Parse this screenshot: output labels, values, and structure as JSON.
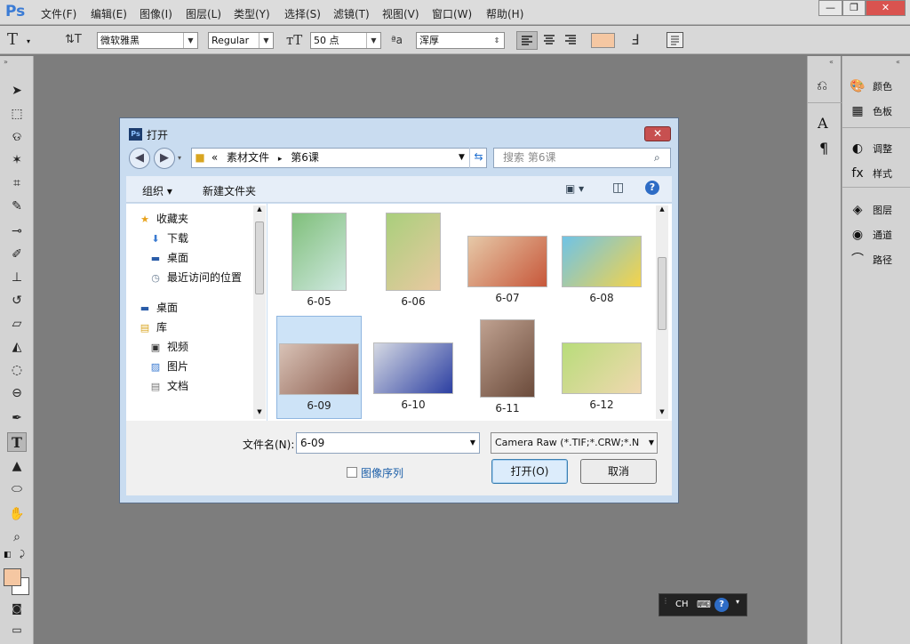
{
  "app": {
    "logo": "Ps"
  },
  "menu": [
    "文件(F)",
    "编辑(E)",
    "图像(I)",
    "图层(L)",
    "类型(Y)",
    "选择(S)",
    "滤镜(T)",
    "视图(V)",
    "窗口(W)",
    "帮助(H)"
  ],
  "window_controls": {
    "minimize": "—",
    "restore": "❐",
    "close": "✕"
  },
  "options": {
    "font_family": "微软雅黑",
    "font_style": "Regular",
    "font_size": "50 点",
    "aa_label": "ªa",
    "anti_alias": "浑厚",
    "text_color": "#f5c7a2"
  },
  "right_panel": [
    {
      "icon": "palette-icon",
      "glyph": "🎨",
      "label": "颜色"
    },
    {
      "icon": "swatches-icon",
      "glyph": "▦",
      "label": "色板"
    },
    {
      "icon": "adjustments-icon",
      "glyph": "◐",
      "label": "调整"
    },
    {
      "icon": "styles-icon",
      "glyph": "fx",
      "label": "样式"
    },
    {
      "icon": "layers-icon",
      "glyph": "◈",
      "label": "图层"
    },
    {
      "icon": "channels-icon",
      "glyph": "◉",
      "label": "通道"
    },
    {
      "icon": "paths-icon",
      "glyph": "⌒",
      "label": "路径"
    }
  ],
  "dialog": {
    "title": "打开",
    "address": {
      "prefix": "«",
      "crumb1": "素材文件",
      "sep": "▸",
      "crumb2": "第6课"
    },
    "search_placeholder": "搜索 第6课",
    "organize": "组织 ▾",
    "new_folder": "新建文件夹",
    "nav": [
      {
        "icon": "star-icon",
        "label": "收藏夹",
        "level": 0
      },
      {
        "icon": "download-icon",
        "label": "下载",
        "level": 1
      },
      {
        "icon": "desktop-icon",
        "label": "桌面",
        "level": 1
      },
      {
        "icon": "recent-icon",
        "label": "最近访问的位置",
        "level": 1
      },
      {
        "icon": "desktop-icon",
        "label": "桌面",
        "level": 0
      },
      {
        "icon": "library-icon",
        "label": "库",
        "level": 0
      },
      {
        "icon": "video-icon",
        "label": "视频",
        "level": 1
      },
      {
        "icon": "picture-icon",
        "label": "图片",
        "level": 1
      },
      {
        "icon": "document-icon",
        "label": "文档",
        "level": 1
      }
    ],
    "files": [
      {
        "name": "6-05",
        "colors": [
          "#7fbf7a",
          "#cfe8e0"
        ],
        "portrait": true
      },
      {
        "name": "6-06",
        "colors": [
          "#a9cf7c",
          "#e9c9a1"
        ],
        "portrait": true
      },
      {
        "name": "6-07",
        "colors": [
          "#e6c9a8",
          "#c7573a"
        ],
        "portrait": false
      },
      {
        "name": "6-08",
        "colors": [
          "#6fc3e6",
          "#f4d34a"
        ],
        "portrait": false
      },
      {
        "name": "6-09",
        "colors": [
          "#d8c2b6",
          "#8a5a4b"
        ],
        "portrait": false
      },
      {
        "name": "6-10",
        "colors": [
          "#d5d9e3",
          "#2c3fa2"
        ],
        "portrait": false
      },
      {
        "name": "6-11",
        "colors": [
          "#bfa190",
          "#6b4b3b"
        ],
        "portrait": true
      },
      {
        "name": "6-12",
        "colors": [
          "#b8dc7a",
          "#f0d8b0"
        ],
        "portrait": false
      }
    ],
    "selected_file": "6-09",
    "filename_label": "文件名(N):",
    "filename_value": "6-09",
    "filetype": "Camera Raw (*.TIF;*.CRW;*.N",
    "image_sequence": "图像序列",
    "open_btn": "打开(O)",
    "cancel_btn": "取消"
  },
  "tray": {
    "lang": "CH"
  }
}
